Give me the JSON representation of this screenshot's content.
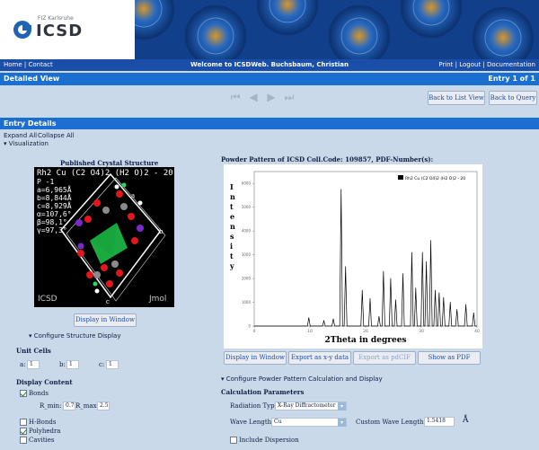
{
  "logo": {
    "small_text": "FIZ Karlsruhe",
    "name": "ICSD"
  },
  "topnav": {
    "home": "Home",
    "contact": "Contact",
    "welcome": "Welcome to ICSDWeb. Buchsbaum, Christian",
    "print": "Print",
    "logout": "Logout",
    "documentation": "Documentation"
  },
  "titlebar": {
    "title": "Detailed View",
    "entry": "Entry 1 of 1"
  },
  "buttons": {
    "back_list": "Back to List View",
    "back_query": "Back to Query"
  },
  "section": {
    "title": "Entry Details",
    "expand": "Expand All",
    "collapse": "Collapse All",
    "visualization": "Visualization"
  },
  "structure": {
    "heading": "Published Crystal Structure",
    "formula": "Rh2 Cu (C2 O4)2 (H2 O)2 - 20",
    "space_group": "P -1",
    "a": "a=6,965Å",
    "b": "b=8,844Å",
    "c": "c=8,929Å",
    "alpha": "α=107,6°",
    "beta": "β=98,1°",
    "gamma": "γ=97,3°",
    "watermark_left": "ICSD",
    "watermark_right": "Jmol",
    "axis_a": "a",
    "axis_b": "b",
    "axis_c": "c",
    "display_button": "Display in Window",
    "configure": "Configure Structure Display"
  },
  "unit_cells": {
    "heading": "Unit Cells",
    "a_label": "a:",
    "a_val": "1",
    "b_label": "b:",
    "b_val": "1",
    "c_label": "c:",
    "c_val": "1"
  },
  "display_content": {
    "heading": "Display Content",
    "bonds": "Bonds",
    "rmin_label": "R_min:",
    "rmin_val": "0.7",
    "rmax_label": "R_max:",
    "rmax_val": "2.5",
    "hbonds": "H-Bonds",
    "polyhedra": "Polyhedra",
    "cavities": "Cavities",
    "bonds_checked": true,
    "hbonds_checked": false,
    "polyhedra_checked": true,
    "cavities_checked": false
  },
  "powder": {
    "heading": "Powder Pattern of ICSD Coll.Code: 109857, PDF-Number(s):",
    "buttons": [
      "Display in Window",
      "Export as x-y data",
      "Export as pdCIF",
      "Show as PDF"
    ],
    "configure": "Configure Powder Pattern Calculation and Display",
    "calc_heading": "Calculation Parameters",
    "radiation_label": "Radiation Type:",
    "radiation_val": "X-Ray Diffractometer",
    "wave_label": "Wave Length:",
    "wave_val": "Cu",
    "custom_label": "Custom Wave Length:",
    "custom_val": "1.5418",
    "custom_unit": "Å",
    "dispersion": "Include Dispersion"
  },
  "chart_data": {
    "type": "line",
    "xlabel": "2Theta in degrees",
    "ylabel": "Intensity",
    "legend": "Rh2 Cu (C2 O4)2 (H2 O)2 - 20",
    "xlim": [
      0,
      40
    ],
    "ylim": [
      0,
      6500
    ],
    "x_ticks": [
      "0",
      "10",
      "20",
      "30",
      "40"
    ],
    "y_ticks": [
      "0",
      "1000",
      "2000",
      "3000",
      "4000",
      "5000",
      "6000"
    ],
    "peaks": [
      {
        "x": 9.8,
        "y": 350
      },
      {
        "x": 12.5,
        "y": 220
      },
      {
        "x": 14.2,
        "y": 300
      },
      {
        "x": 15.6,
        "y": 5750
      },
      {
        "x": 16.4,
        "y": 2500
      },
      {
        "x": 19.4,
        "y": 1500
      },
      {
        "x": 20.8,
        "y": 1150
      },
      {
        "x": 22.4,
        "y": 400
      },
      {
        "x": 23.2,
        "y": 2300
      },
      {
        "x": 24.5,
        "y": 2000
      },
      {
        "x": 25.4,
        "y": 1100
      },
      {
        "x": 26.7,
        "y": 2200
      },
      {
        "x": 28.3,
        "y": 3100
      },
      {
        "x": 29.0,
        "y": 1600
      },
      {
        "x": 30.2,
        "y": 3100
      },
      {
        "x": 30.9,
        "y": 2700
      },
      {
        "x": 31.7,
        "y": 3600
      },
      {
        "x": 32.5,
        "y": 1500
      },
      {
        "x": 33.2,
        "y": 1400
      },
      {
        "x": 34.0,
        "y": 1200
      },
      {
        "x": 35.2,
        "y": 1000
      },
      {
        "x": 36.4,
        "y": 700
      },
      {
        "x": 38.0,
        "y": 900
      },
      {
        "x": 39.4,
        "y": 550
      }
    ]
  }
}
